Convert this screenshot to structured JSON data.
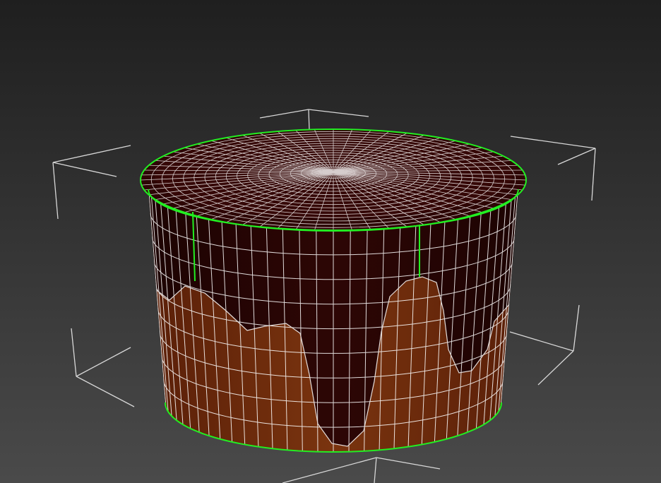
{
  "viewport": {
    "background_top": "#1f1f1f",
    "background_bottom": "#4a4a4a",
    "wire_color": "#ffffff",
    "selection_edge_color": "#22ee22",
    "bbox_color": "#d8d8d8",
    "frosting_color": "#2d0605",
    "frosting_dark": "#1c0302",
    "sponge_color": "#5a1f08",
    "sponge_light": "#7a340f"
  },
  "object": {
    "name_icon": "cake-mesh",
    "selected": true
  }
}
